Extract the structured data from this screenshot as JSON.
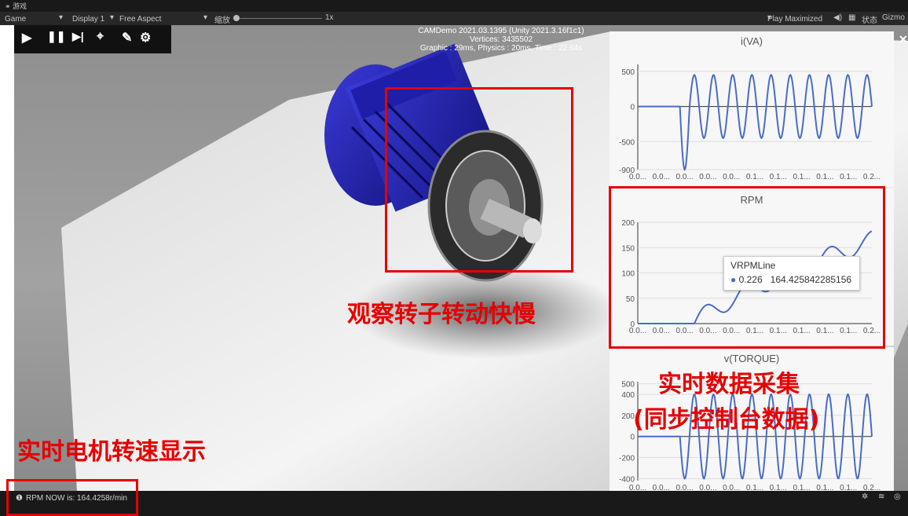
{
  "window": {
    "tab_title": "游戏"
  },
  "toolbar": {
    "view_label": "Game",
    "display_label": "Display 1",
    "aspect_label": "Free Aspect",
    "scale_label": "缩放",
    "scale_value": "1x",
    "play_mode_label": "Play Maximized",
    "status_label": "状态",
    "gizmos_label": "Gizmo"
  },
  "stats": {
    "line1": "CAMDemo 2021.03.1395 (Unity 2021.3.16f1c1)",
    "line2": "Vertices: 3435502",
    "line3": "Graphic : 29ms, Physics : 20ms, Time : 22.64s"
  },
  "annotations": {
    "rotor": "观察转子转动快慢",
    "collect_line1": "实时数据采集",
    "collect_line2": "(同步控制台数据)",
    "rpm_display": "实时电机转速显示"
  },
  "status": {
    "message": "RPM NOW is: 164.4258r/min"
  },
  "colors": {
    "series": "#4a6cc4",
    "annotation": "#e60000"
  },
  "chart_data": [
    {
      "type": "line",
      "title": "i(VA)",
      "x_tick_labels": [
        "0.0...",
        "0.0...",
        "0.0...",
        "0.0...",
        "0.0...",
        "0.1...",
        "0.1...",
        "0.1...",
        "0.1...",
        "0.1...",
        "0.2..."
      ],
      "yticks": [
        "500",
        "0",
        "-500",
        "-900"
      ],
      "ylim": [
        -900,
        600
      ],
      "series": [
        {
          "shape": "sine",
          "onset_fraction": 0.18,
          "amplitude": 450,
          "cycles": 10,
          "first_trough": -900
        }
      ]
    },
    {
      "type": "line",
      "title": "RPM",
      "x_tick_labels": [
        "0.0...",
        "0.0...",
        "0.0...",
        "0.0...",
        "0.0...",
        "0.1...",
        "0.1...",
        "0.1...",
        "0.1...",
        "0.1...",
        "0.2..."
      ],
      "yticks": [
        "200",
        "150",
        "100",
        "50",
        "0"
      ],
      "ylim": [
        0,
        200
      ],
      "tooltip": {
        "series": "VRPMLine",
        "x": "0.226",
        "y": "164.425842285156"
      },
      "series": [
        {
          "name": "VRPMLine",
          "shape": "rising_wave",
          "onset_fraction": 0.2,
          "end_value": 164.4
        }
      ]
    },
    {
      "type": "line",
      "title": "v(TORQUE)",
      "x_tick_labels": [
        "0.0...",
        "0.0...",
        "0.0...",
        "0.0...",
        "0.0...",
        "0.1...",
        "0.1...",
        "0.1...",
        "0.1...",
        "0.1...",
        "0.2..."
      ],
      "yticks": [
        "500",
        "400",
        "200",
        "0",
        "-200",
        "-400"
      ],
      "ylim": [
        -420,
        520
      ],
      "series": [
        {
          "shape": "sine",
          "onset_fraction": 0.18,
          "amplitude": 400,
          "cycles": 10
        }
      ]
    }
  ]
}
